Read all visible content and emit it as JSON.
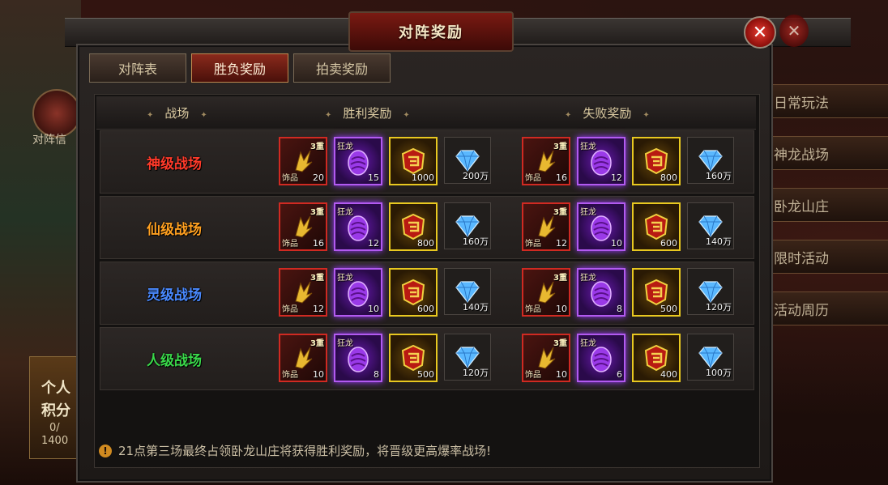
{
  "background": {
    "left_label": "对阵信",
    "left_card": {
      "line1": "个人",
      "line2": "积分",
      "line3": "0/",
      "line4": "1400"
    },
    "side_tabs": [
      "日常玩法",
      "神龙战场",
      "卧龙山庄",
      "限时活动",
      "活动周历"
    ]
  },
  "dialog": {
    "title": "对阵奖励",
    "close_icon": "close-icon",
    "tabs": [
      {
        "label": "对阵表",
        "active": false
      },
      {
        "label": "胜负奖励",
        "active": true
      },
      {
        "label": "拍卖奖励",
        "active": false
      }
    ],
    "header": {
      "battlefield": "战场",
      "win": "胜利奖励",
      "lose": "失败奖励"
    },
    "rows": [
      {
        "name": "神级战场",
        "color": "#ff3a2a",
        "win": {
          "ornament": "20",
          "dragon": "15",
          "gold": "1000",
          "gem": "200万"
        },
        "lose": {
          "ornament": "16",
          "dragon": "12",
          "gold": "800",
          "gem": "160万"
        }
      },
      {
        "name": "仙级战场",
        "color": "#ffa020",
        "win": {
          "ornament": "16",
          "dragon": "12",
          "gold": "800",
          "gem": "160万"
        },
        "lose": {
          "ornament": "12",
          "dragon": "10",
          "gold": "600",
          "gem": "140万"
        }
      },
      {
        "name": "灵级战场",
        "color": "#4a8aff",
        "win": {
          "ornament": "12",
          "dragon": "10",
          "gold": "600",
          "gem": "140万"
        },
        "lose": {
          "ornament": "10",
          "dragon": "8",
          "gold": "500",
          "gem": "120万"
        }
      },
      {
        "name": "人级战场",
        "color": "#3ad84a",
        "win": {
          "ornament": "10",
          "dragon": "8",
          "gold": "500",
          "gem": "120万"
        },
        "lose": {
          "ornament": "10",
          "dragon": "6",
          "gold": "400",
          "gem": "100万"
        }
      }
    ],
    "item_labels": {
      "ornament_tag": "饰品",
      "ornament_grade": "3重",
      "dragon_tag": "狂龙"
    },
    "notice": "21点第三场最终占领卧龙山庄将获得胜利奖励，将晋级更高爆率战场!"
  }
}
